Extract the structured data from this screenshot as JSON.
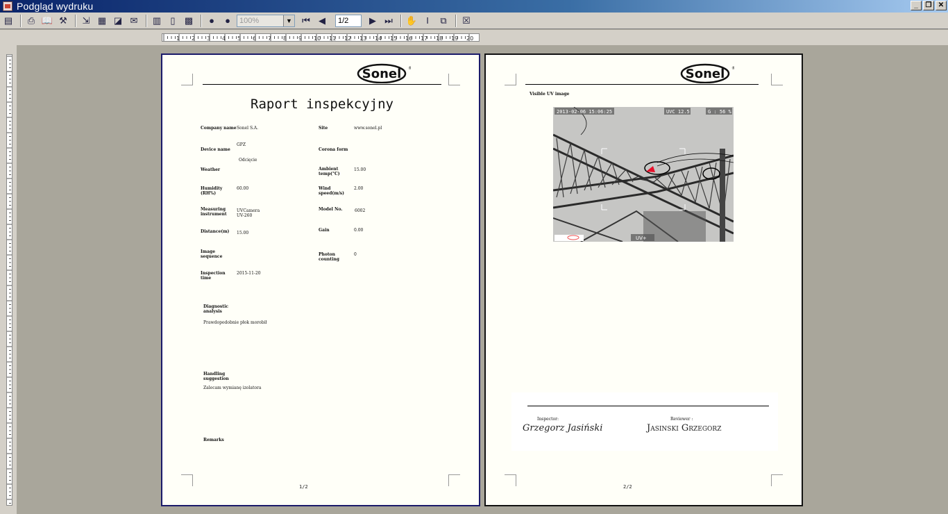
{
  "window": {
    "title": "Podgląd wydruku"
  },
  "toolbar": {
    "zoom": "100%",
    "page_box": "1/2"
  },
  "page1": {
    "title": "Raport inspekcyjny",
    "fields": [
      {
        "label": "Company name",
        "value": "Sonel S.A."
      },
      {
        "label": "Site",
        "value": "www.sonel.pl"
      },
      {
        "label": "Device name",
        "value": "GPZ"
      },
      {
        "label": "Corona form",
        "value": ""
      },
      {
        "label": "Weather",
        "value": ""
      },
      {
        "label": "Ambient temp(°C)",
        "value": "15.00"
      },
      {
        "label": "Humidity (RH%)",
        "value": "60.00"
      },
      {
        "label": "Wind speed(m/s)",
        "value": "2.00"
      },
      {
        "label": "Measuring instrument",
        "value": "UVCamera UV-260"
      },
      {
        "label": "Model No.",
        "value": "6002"
      },
      {
        "label": "Distance(m)",
        "value": "15.00"
      },
      {
        "label": "Gain",
        "value": "0.00"
      },
      {
        "label": "Image sequence",
        "value": ""
      },
      {
        "label": "Photon counting",
        "value": "0"
      },
      {
        "label": "Inspection time",
        "value": "2015-11-20"
      }
    ],
    "device_sub": "Odcięcie",
    "diagnostic_label": "Diagnostic analysis",
    "diagnostic_text": "Prawdopodobnie płok morobił",
    "handling_label": "Handling suggestion",
    "handling_text": "Zalecam wymianę izolatora",
    "remarks_label": "Remarks",
    "page_number": "1/2"
  },
  "page2": {
    "image_caption": "Visible UV image",
    "photo_timestamp": "2013-02-06 15:06:25",
    "photo_uvc": "UVC 12.5",
    "photo_gain": "G : 56 %",
    "photo_mode": "UV+",
    "inspector_label": "Inspector:",
    "inspector_signature": "Grzegorz Jasiński",
    "reviewer_label": "Reviewer :",
    "reviewer_signature": "Jasinski Grzegorz",
    "page_number": "2/2"
  },
  "logo_text": "Sonel"
}
